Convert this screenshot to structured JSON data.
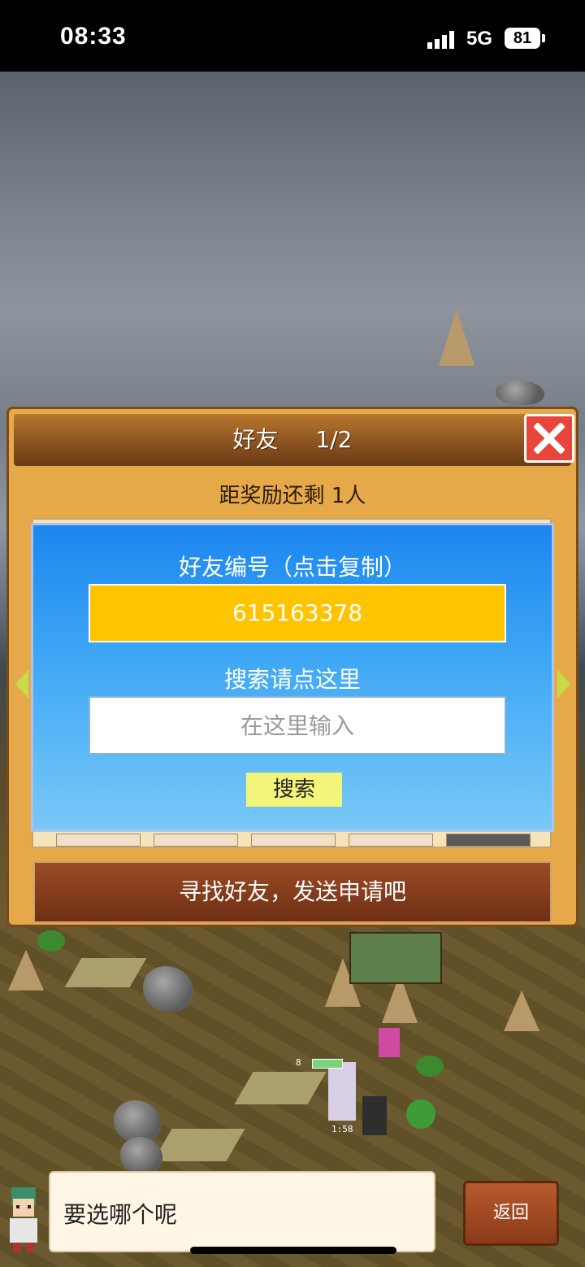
{
  "status_bar": {
    "time": "08:33",
    "network": "5G",
    "battery": "81"
  },
  "friend_panel": {
    "title": "好友",
    "page": "1/2",
    "reward_text": "距奖励还剩 1人",
    "find_button_label": "寻找好友，发送申请吧"
  },
  "friend_dialog": {
    "id_label": "好友编号（点击复制）",
    "friend_id": "615163378",
    "search_label": "搜索请点这里",
    "search_placeholder": "在这里输入",
    "search_button": "搜索"
  },
  "game_hud": {
    "unit_level": "8",
    "unit_timer": "1:58"
  },
  "dialog_bar": {
    "prompt": "要选哪个呢",
    "back_button": "返回"
  },
  "colors": {
    "panel_bg": "#e5a94a",
    "dialog_blue": "#1c86ef",
    "id_field": "#ffc400",
    "close_red": "#e8463b",
    "search_button": "#f3f57a"
  }
}
